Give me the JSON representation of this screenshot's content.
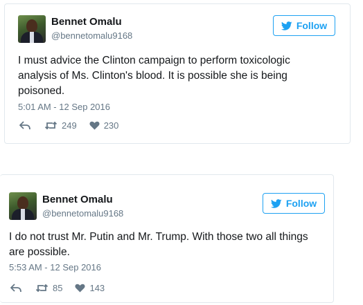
{
  "tweets": [
    {
      "name": "Bennet Omalu",
      "handle": "@bennetomalu9168",
      "follow_label": "Follow",
      "text": "I must advice the Clinton campaign to perform toxicologic analysis of Ms. Clinton's blood. It is possible she is being poisoned.",
      "time": "5:01 AM - 12 Sep 2016",
      "retweets": "249",
      "likes": "230"
    },
    {
      "name": "Bennet Omalu",
      "handle": "@bennetomalu9168",
      "follow_label": "Follow",
      "text": "I do not trust Mr. Putin and Mr. Trump. With those two all things are possible.",
      "time": "5:53 AM - 12 Sep 2016",
      "retweets": "85",
      "likes": "143"
    }
  ],
  "colors": {
    "accent": "#1da1f2",
    "muted": "#657786",
    "text": "#14171a",
    "border": "#e1e8ed"
  },
  "icons": {
    "reply": "reply-icon",
    "retweet": "retweet-icon",
    "like": "heart-icon",
    "follow": "twitter-bird-icon"
  }
}
